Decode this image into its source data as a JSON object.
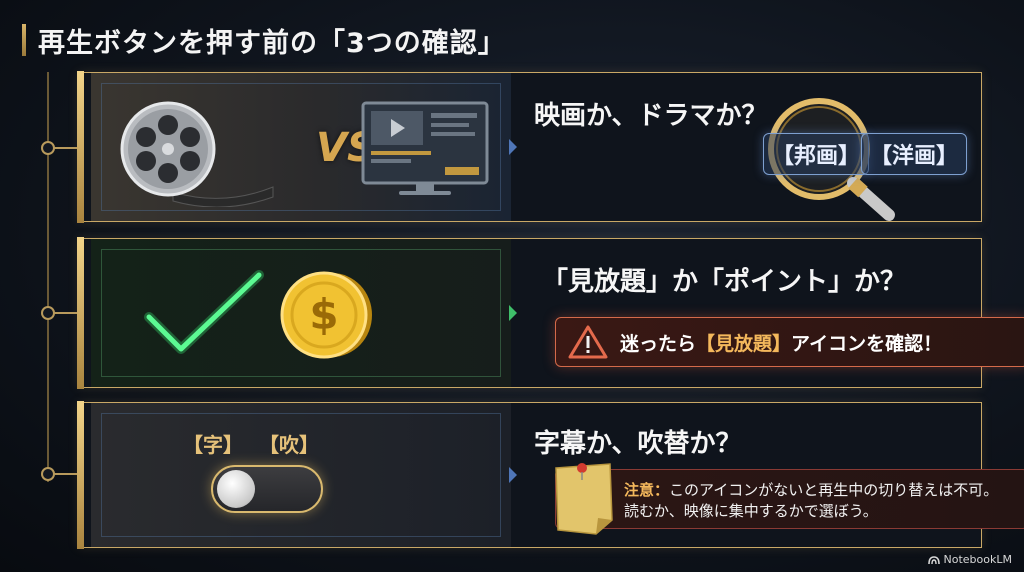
{
  "title": "再生ボタンを押す前の「3つの確認」",
  "cards": [
    {
      "question": "映画か、ドラマか？",
      "vs": "VS",
      "tags": [
        "【邦画】",
        "【洋画】"
      ]
    },
    {
      "question": "「見放題」か「ポイント」か？",
      "warning": {
        "prefix": "迷ったら",
        "highlight": "【見放題】",
        "suffix": "アイコンを確認！"
      }
    },
    {
      "question": "字幕か、吹替か？",
      "tags": [
        "【字】",
        "【吹】"
      ],
      "note": {
        "label": "注意：",
        "line1": "このアイコンがないと再生中の切り替えは不可。",
        "line2": "読むか、映像に集中するかで選ぼう。"
      }
    }
  ],
  "brand": "NotebookLM",
  "colors": {
    "gold": "#c9a866",
    "neon_green": "#3cf07a",
    "warning_red": "#d46a4a",
    "highlight_orange": "#f4b85c"
  },
  "icons": [
    "film-reel-icon",
    "tv-icon",
    "magnifier-icon",
    "checkmark-icon",
    "dollar-coin-icon",
    "warning-icon",
    "toggle-switch",
    "sticky-note-icon"
  ]
}
